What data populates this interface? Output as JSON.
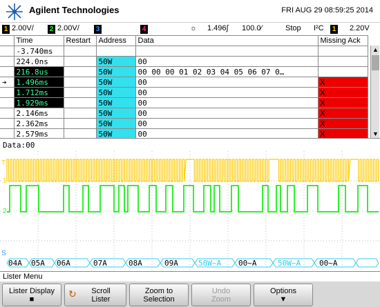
{
  "header": {
    "brand": "Agilent Technologies",
    "datetime": "FRI AUG 29 08:59:25 2014"
  },
  "status": {
    "ch1_num": "1",
    "ch1_scale": "2.00V/",
    "ch2_num": "2",
    "ch2_scale": "2.00V/",
    "ch3_num": "3",
    "ch4_num": "4",
    "time_pos": "1.496",
    "time_unit": "∫",
    "timebase": "100.0⁄",
    "run_state": "Stop",
    "protocol": "I²C",
    "trig_ch": "1",
    "trig_level": "2.20V"
  },
  "lister": {
    "columns": [
      "Time",
      "Restart",
      "Address",
      "Data",
      "Missing Ack"
    ],
    "rows": [
      {
        "marker": "",
        "time": "-3.740ms",
        "restart": "",
        "address": "",
        "data": "",
        "missing": "",
        "time_hl": false,
        "addr_hl": false,
        "miss_hl": false
      },
      {
        "marker": "",
        "time": "224.0ns",
        "restart": "",
        "address": "50W",
        "data": "00",
        "missing": "",
        "time_hl": false,
        "addr_hl": true,
        "miss_hl": false
      },
      {
        "marker": "",
        "time": "216.8us",
        "restart": "",
        "address": "50W",
        "data": "00 00 00 01 02 03 04 05 06 07 0…",
        "missing": "",
        "time_hl": true,
        "addr_hl": true,
        "miss_hl": false
      },
      {
        "marker": "➔",
        "time": "1.496ms",
        "restart": "",
        "address": "50W",
        "data": "00",
        "missing": "X",
        "time_hl": true,
        "addr_hl": true,
        "miss_hl": true
      },
      {
        "marker": "",
        "time": "1.712ms",
        "restart": "",
        "address": "50W",
        "data": "00",
        "missing": "X",
        "time_hl": true,
        "addr_hl": true,
        "miss_hl": true
      },
      {
        "marker": "",
        "time": "1.929ms",
        "restart": "",
        "address": "50W",
        "data": "00",
        "missing": "X",
        "time_hl": true,
        "addr_hl": true,
        "miss_hl": true
      },
      {
        "marker": "",
        "time": "2.146ms",
        "restart": "",
        "address": "50W",
        "data": "00",
        "missing": "X",
        "time_hl": false,
        "addr_hl": true,
        "miss_hl": true
      },
      {
        "marker": "",
        "time": "2.362ms",
        "restart": "",
        "address": "50W",
        "data": "00",
        "missing": "X",
        "time_hl": false,
        "addr_hl": true,
        "miss_hl": true
      },
      {
        "marker": "",
        "time": "2.579ms",
        "restart": "",
        "address": "50W",
        "data": "00",
        "missing": "X",
        "time_hl": false,
        "addr_hl": true,
        "miss_hl": true
      }
    ]
  },
  "data_line": "Data:00",
  "wave_labels": {
    "t": "T",
    "ch1": "1",
    "ch2": "2",
    "s": "S"
  },
  "bus_labels": [
    {
      "text": "04A",
      "w": false
    },
    {
      "text": "05A",
      "w": false
    },
    {
      "text": "06A",
      "w": false
    },
    {
      "text": "07A",
      "w": false
    },
    {
      "text": "08A",
      "w": false
    },
    {
      "text": "09A",
      "w": false
    },
    {
      "text": "50W~A",
      "w": true
    },
    {
      "text": "00~A",
      "w": false
    },
    {
      "text": "50W~A",
      "w": true
    },
    {
      "text": "00~A",
      "w": false
    }
  ],
  "menu": {
    "title": "Lister Menu",
    "keys": [
      {
        "l1": "Lister Display",
        "l2": "■",
        "enabled": true
      },
      {
        "l1": "Scroll",
        "l2": "Lister",
        "enabled": true
      },
      {
        "l1": "Zoom to",
        "l2": "Selection",
        "enabled": true
      },
      {
        "l1": "Undo",
        "l2": "Zoom",
        "enabled": false
      },
      {
        "l1": "Options",
        "l2": "▼",
        "enabled": true
      }
    ]
  },
  "colors": {
    "ch1": "#ffcc00",
    "ch2": "#33ee33",
    "bus": "#33ccee",
    "miss": "#ee0000"
  }
}
